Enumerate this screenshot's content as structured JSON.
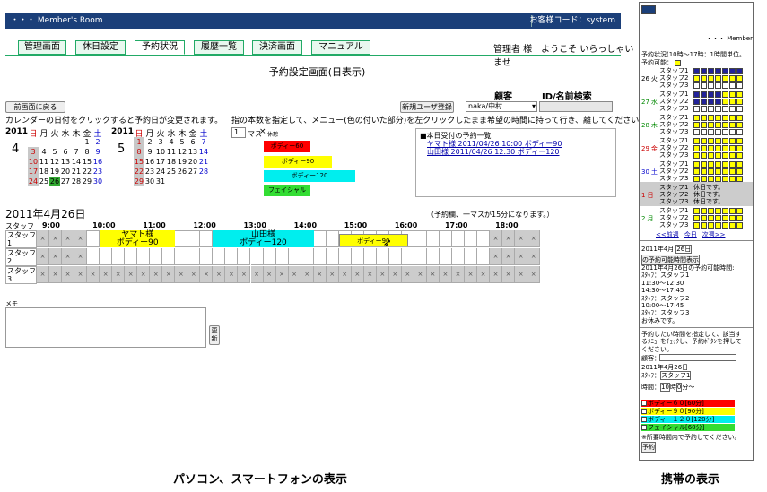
{
  "header": {
    "app_title": "・・・ Member's Room",
    "customer_code": "お客様コード：system"
  },
  "tabs": [
    "管理画面",
    "休日設定",
    "予約状況",
    "履歴一覧",
    "決済画面",
    "マニュアル"
  ],
  "welcome": "管理者 様　ようこそ いらっしゃいませ",
  "page_title": "予約設定画面(日表示)",
  "back_button": "前画面に戻る",
  "calendar_hint": "カレンダーの日付をクリックすると予約日が変更されます。",
  "search": {
    "customer_label": "顧客",
    "id_label": "ID/名前検索",
    "new_user_button": "新規ユーザ登録",
    "customer_value": "naka/中村"
  },
  "menu_hint": "指の本数を指定して、メニュー(色の付いた部分)を左クリックしたまま希望の時間に持って行き、離してください。",
  "count_select": "1",
  "count_label": "マス",
  "break_label": "休憩",
  "menus": [
    "ボディー60",
    "ボディー90",
    "ボディー120",
    "フェイシャル"
  ],
  "todays_list": {
    "title": "■本日受付の予約一覧",
    "items": [
      "ヤマト様 2011/04/26 10:00 ボディー90",
      "山田様 2011/04/26 12:30 ボディー120"
    ]
  },
  "cal_year": "2011",
  "cal_months": [
    "4",
    "5"
  ],
  "weekdays": [
    "日",
    "月",
    "火",
    "水",
    "木",
    "金",
    "土"
  ],
  "april": [
    "",
    "",
    "",
    "",
    "",
    "1",
    "2",
    "3",
    "4",
    "5",
    "6",
    "7",
    "8",
    "9",
    "10",
    "11",
    "12",
    "13",
    "14",
    "15",
    "16",
    "17",
    "18",
    "19",
    "20",
    "21",
    "22",
    "23",
    "24",
    "25",
    "26",
    "27",
    "28",
    "29",
    "30"
  ],
  "may": [
    "1",
    "2",
    "3",
    "4",
    "5",
    "6",
    "7",
    "8",
    "9",
    "10",
    "11",
    "12",
    "13",
    "14",
    "15",
    "16",
    "17",
    "18",
    "19",
    "20",
    "21",
    "22",
    "23",
    "24",
    "25",
    "26",
    "27",
    "28",
    "29",
    "30",
    "31"
  ],
  "schedule": {
    "date": "2011年4月26日",
    "note": "（予約欄、一マスが15分になります。）",
    "staff_header": "スタッフ",
    "hours": [
      "9:00",
      "10:00",
      "11:00",
      "12:00",
      "13:00",
      "14:00",
      "15:00",
      "16:00",
      "17:00",
      "18:00"
    ],
    "staff": [
      "スタッフ1",
      "スタッフ2",
      "スタッフ3"
    ],
    "bookings": [
      {
        "name": "ヤマト様",
        "menu": "ボディー90"
      },
      {
        "name": "山田様",
        "menu": "ボディー120"
      }
    ],
    "dragging": "ボディー90",
    "x_mark": "×"
  },
  "memo_label": "メモ",
  "update_button": "更新",
  "captions": {
    "pc": "パソコン、スマートフォンの表示",
    "mobile": "携帯の表示"
  },
  "mobile": {
    "top": "・・・ Member",
    "status_line": "予約状況(10時〜17時：1時間単位。",
    "avail": "予約可能：",
    "days": [
      {
        "d": "26",
        "w": "火",
        "c": "#000"
      },
      {
        "d": "27",
        "w": "水",
        "c": "#080"
      },
      {
        "d": "28",
        "w": "木",
        "c": "#080"
      },
      {
        "d": "29",
        "w": "金",
        "c": "#c00"
      },
      {
        "d": "30",
        "w": "土",
        "c": "#00c"
      },
      {
        "d": "1",
        "w": "日",
        "c": "#c00"
      },
      {
        "d": "2",
        "w": "月",
        "c": "#080"
      }
    ],
    "staff": [
      "スタッフ1",
      "スタッフ2",
      "スタッフ3"
    ],
    "holiday": "休日です。",
    "nav": [
      "<<前週",
      "今日",
      "次週>>"
    ],
    "date_box": "2011年4月",
    "date_day": "26日",
    "avail_btn": "の予約可能時間表示",
    "avail_lines": [
      "2011年4月26日の予約可能時間:",
      "ｽﾀｯﾌ：スタッフ1",
      "11:30〜12:30",
      "14:30〜17:45",
      "ｽﾀｯﾌ：スタッフ2",
      "10:00〜17:45",
      "ｽﾀｯﾌ：スタッフ3",
      "お休みです。"
    ],
    "instr": [
      "予約したい時間を指定して、該当す",
      "るﾒﾆｭｰをﾁｪｯｸし、予約ﾎﾞﾀﾝを押して",
      "ください。"
    ],
    "customer": "顧客：",
    "date": "2011年4月26日",
    "staff_label": "ｽﾀｯﾌ：",
    "staff_val": "スタッフ1",
    "time_label": "時間：",
    "hour": "10",
    "min": "0",
    "time_suffix": "分〜",
    "menus": [
      {
        "t": "ボディー６０[60分]",
        "c": "#f00"
      },
      {
        "t": "ボディー９０[90分]",
        "c": "#ff0"
      },
      {
        "t": "ボディー１２０[120分]",
        "c": "#0ee"
      },
      {
        "t": "フェイシャル[60分]",
        "c": "#3d3"
      }
    ],
    "footer": "※所要時間内で予約してください。",
    "reserve_btn": "予約"
  }
}
